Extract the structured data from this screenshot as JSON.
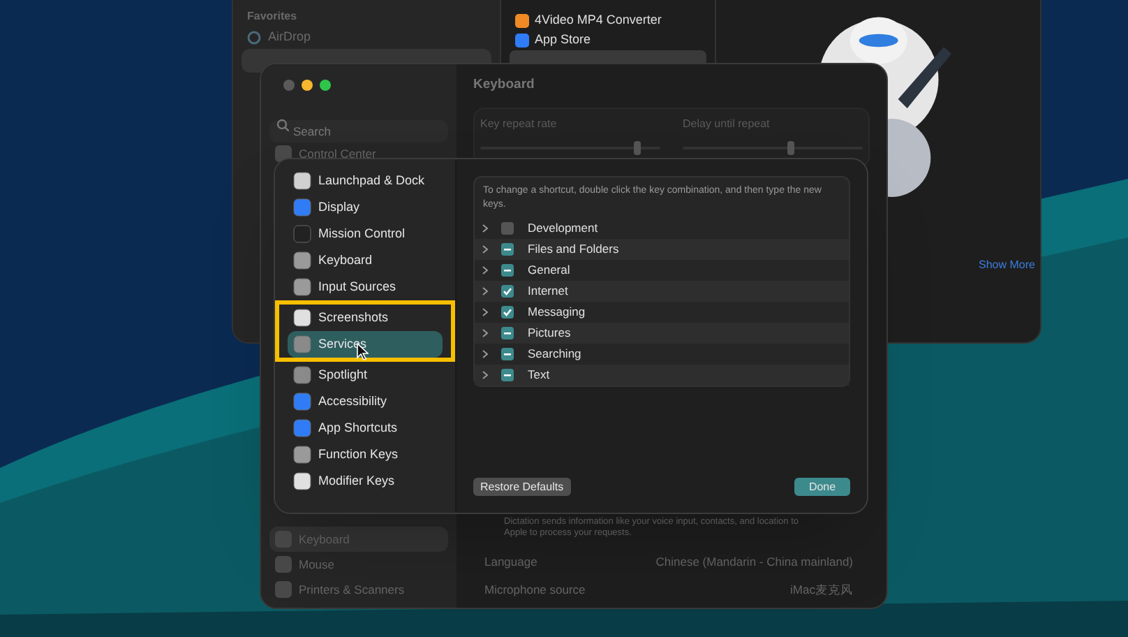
{
  "finder": {
    "sidebar_heading": "Favorites",
    "sidebar_items": [
      {
        "label": "AirDrop"
      }
    ],
    "apps": [
      {
        "label": "4Video MP4 Converter"
      },
      {
        "label": "App Store"
      }
    ],
    "show_more": "Show More"
  },
  "settings": {
    "title": "Keyboard",
    "search_placeholder": "Search",
    "sidebar_top": [
      {
        "label": "Control Center",
        "selected": false
      }
    ],
    "sidebar_bottom": [
      {
        "label": "Keyboard",
        "selected": true
      },
      {
        "label": "Mouse",
        "selected": false
      },
      {
        "label": "Printers & Scanners",
        "selected": false
      }
    ],
    "sliders": [
      {
        "label": "Key repeat rate",
        "level": 0.87
      },
      {
        "label": "Delay until repeat",
        "level": 0.6
      }
    ],
    "dictation_note": "Dictation sends information like your voice input, contacts, and location to Apple to process your requests.",
    "rows": [
      {
        "label": "Language",
        "value": "Chinese (Mandarin - China mainland)"
      },
      {
        "label": "Microphone source",
        "value": "iMac麦克风"
      }
    ]
  },
  "sheet": {
    "categories": [
      {
        "label": "Launchpad & Dock",
        "selected": false
      },
      {
        "label": "Display",
        "selected": false
      },
      {
        "label": "Mission Control",
        "selected": false
      },
      {
        "label": "Keyboard",
        "selected": false
      },
      {
        "label": "Input Sources",
        "selected": false
      },
      {
        "label": "Screenshots",
        "selected": false
      },
      {
        "label": "Services",
        "selected": true
      },
      {
        "label": "Spotlight",
        "selected": false
      },
      {
        "label": "Accessibility",
        "selected": false
      },
      {
        "label": "App Shortcuts",
        "selected": false
      },
      {
        "label": "Function Keys",
        "selected": false
      },
      {
        "label": "Modifier Keys",
        "selected": false
      }
    ],
    "info": "To change a shortcut, double click the key combination, and then type the new keys.",
    "services": [
      {
        "label": "Development",
        "checked": false,
        "mixed": false,
        "expanded": false
      },
      {
        "label": "Files and Folders",
        "checked": false,
        "mixed": true,
        "expanded": false
      },
      {
        "label": "General",
        "checked": false,
        "mixed": true,
        "expanded": false
      },
      {
        "label": "Internet",
        "checked": true,
        "mixed": false,
        "expanded": false
      },
      {
        "label": "Messaging",
        "checked": true,
        "mixed": false,
        "expanded": false
      },
      {
        "label": "Pictures",
        "checked": false,
        "mixed": true,
        "expanded": false
      },
      {
        "label": "Searching",
        "checked": false,
        "mixed": true,
        "expanded": false
      },
      {
        "label": "Text",
        "checked": false,
        "mixed": true,
        "expanded": false
      }
    ],
    "restore_button": "Restore Defaults",
    "done_button": "Done"
  },
  "highlight": {
    "visible": true
  }
}
